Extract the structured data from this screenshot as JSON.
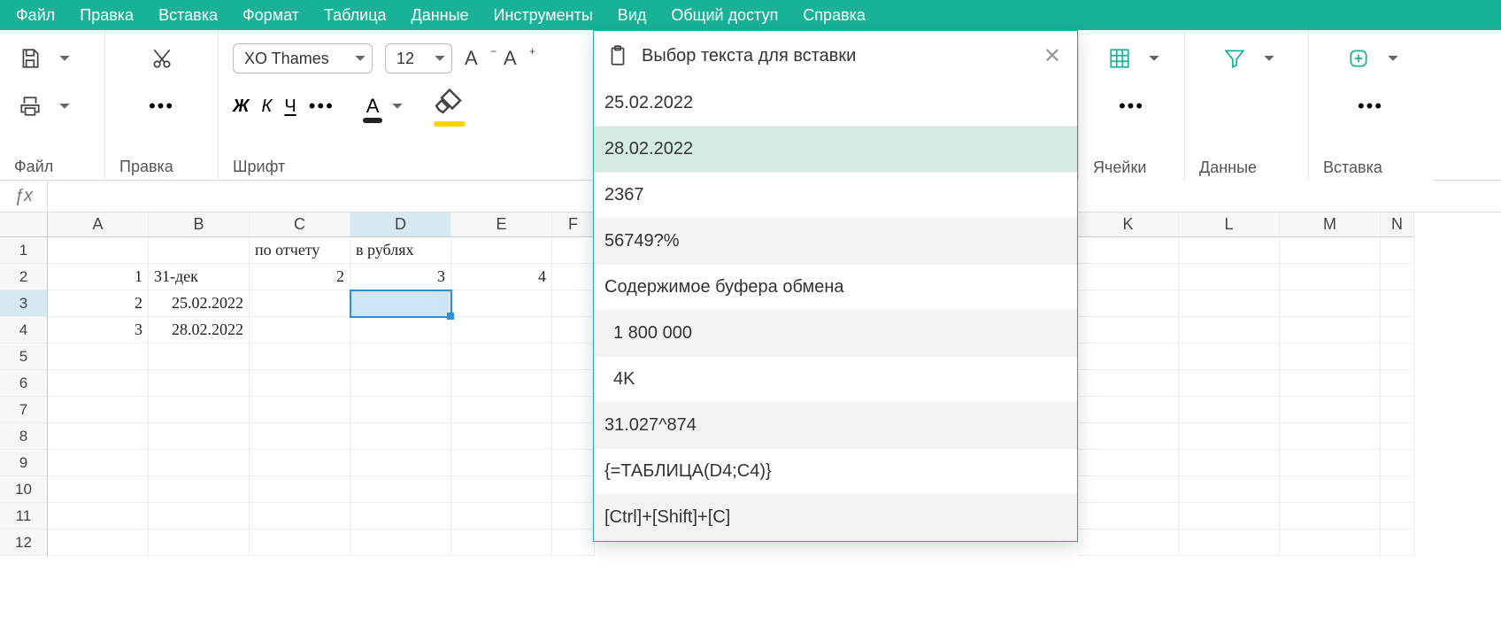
{
  "menu": {
    "items": [
      "Файл",
      "Правка",
      "Вставка",
      "Формат",
      "Таблица",
      "Данные",
      "Инструменты",
      "Вид",
      "Общий доступ",
      "Справка"
    ]
  },
  "ribbon": {
    "groups": {
      "file": "Файл",
      "edit": "Правка",
      "font": "Шрифт",
      "cells": "Ячейки",
      "data": "Данные",
      "insert": "Вставка"
    },
    "font_name": "XO Thames",
    "font_size": "12"
  },
  "formula": "",
  "grid": {
    "cols_left": [
      "A",
      "B",
      "C",
      "D",
      "E",
      "F"
    ],
    "cols_right": [
      "K",
      "L",
      "M",
      "N"
    ],
    "rows": [
      "1",
      "2",
      "3",
      "4",
      "5",
      "6",
      "7",
      "8",
      "9",
      "10",
      "11",
      "12"
    ],
    "cells": {
      "C1": "по отчету",
      "D1": "в рублях",
      "A2": "1",
      "B2": "31-дек",
      "C2": "2",
      "D2": "3",
      "E2": "4",
      "A3": "2",
      "B3": "25.02.2022",
      "A4": "3",
      "B4": "28.02.2022"
    },
    "selected": "D3",
    "selected_row": "3",
    "selected_col": "D"
  },
  "panel": {
    "title": "Выбор текста для вставки",
    "items": [
      {
        "text": "25.02.2022",
        "kind": "plain"
      },
      {
        "text": "28.02.2022",
        "kind": "hl"
      },
      {
        "text": "2367",
        "kind": "plain"
      },
      {
        "text": "56749?%",
        "kind": "alt"
      },
      {
        "text": "Содержимое буфера обмена",
        "kind": "section"
      },
      {
        "text": "1 800 000",
        "kind": "alt indent"
      },
      {
        "text": "4K",
        "kind": "indent"
      },
      {
        "text": "31.027^874",
        "kind": "alt"
      },
      {
        "text": "{=ТАБЛИЦА(D4;C4)}",
        "kind": "plain"
      },
      {
        "text": "[Ctrl]+[Shift]+[C]",
        "kind": "alt"
      }
    ]
  }
}
